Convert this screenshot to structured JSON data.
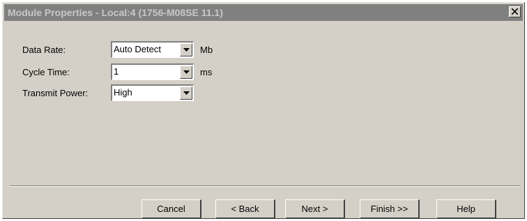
{
  "window": {
    "title": "Module Properties - Local:4 (1756-M08SE 11.1)",
    "close_icon": "close-icon"
  },
  "form": {
    "data_rate": {
      "label": "Data Rate:",
      "value": "Auto Detect",
      "unit": "Mb"
    },
    "cycle_time": {
      "label": "Cycle Time:",
      "value": "1",
      "unit": "ms"
    },
    "transmit_power": {
      "label": "Transmit Power:",
      "value": "High"
    }
  },
  "buttons": {
    "cancel": "Cancel",
    "back": "< Back",
    "next": "Next >",
    "finish": "Finish >>",
    "help": "Help"
  },
  "colors": {
    "face": "#d4d0c8",
    "titlebar_inactive": "#808080",
    "title_text_inactive": "#c8c8c8"
  }
}
